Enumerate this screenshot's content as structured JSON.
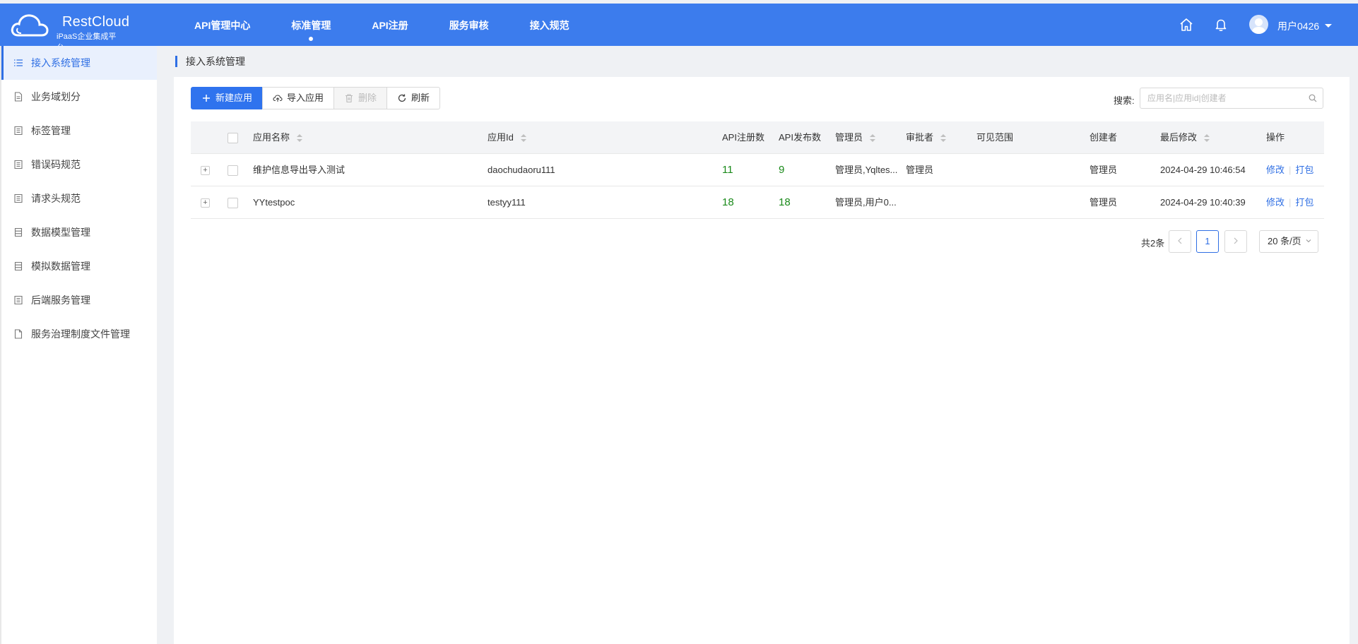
{
  "brand": {
    "title": "RestCloud",
    "subtitle": "iPaaS企业集成平台"
  },
  "topnav": [
    {
      "label": "API管理中心"
    },
    {
      "label": "标准管理",
      "active": true
    },
    {
      "label": "API注册"
    },
    {
      "label": "服务审核"
    },
    {
      "label": "接入规范"
    }
  ],
  "user": {
    "name": "用户0426"
  },
  "sidebar": {
    "items": [
      {
        "label": "接入系统管理",
        "icon": "list-icon",
        "active": true
      },
      {
        "label": "业务域划分",
        "icon": "document-icon"
      },
      {
        "label": "标签管理",
        "icon": "form-icon"
      },
      {
        "label": "错误码规范",
        "icon": "form-icon"
      },
      {
        "label": "请求头规范",
        "icon": "form-icon"
      },
      {
        "label": "数据模型管理",
        "icon": "database-icon"
      },
      {
        "label": "模拟数据管理",
        "icon": "database-icon"
      },
      {
        "label": "后端服务管理",
        "icon": "form-icon"
      },
      {
        "label": "服务治理制度文件管理",
        "icon": "file-icon"
      }
    ]
  },
  "breadcrumb": "接入系统管理",
  "toolbar": {
    "new_label": "新建应用",
    "import_label": "导入应用",
    "delete_label": "删除",
    "refresh_label": "刷新"
  },
  "search": {
    "label": "搜索:",
    "placeholder": "应用名|应用id|创建者"
  },
  "table": {
    "headers": {
      "name": "应用名称",
      "app_id": "应用Id",
      "api_reg": "API注册数",
      "api_pub": "API发布数",
      "admin": "管理员",
      "approver": "审批者",
      "scope": "可见范围",
      "creator": "创建者",
      "modified": "最后修改",
      "ops": "操作"
    },
    "rows": [
      {
        "name": "维护信息导出导入测试",
        "app_id": "daochudaoru111",
        "api_reg": "11",
        "api_pub": "9",
        "admin": "管理员,Yqltes...",
        "approver": "管理员",
        "scope": "",
        "creator": "管理员",
        "modified": "2024-04-29 10:46:54",
        "edit": "修改",
        "pack": "打包"
      },
      {
        "name": "YYtestpoc",
        "app_id": "testyy111",
        "api_reg": "18",
        "api_pub": "18",
        "admin": "管理员,用户0...",
        "approver": "",
        "scope": "",
        "creator": "管理员",
        "modified": "2024-04-29 10:40:39",
        "edit": "修改",
        "pack": "打包"
      }
    ]
  },
  "pagination": {
    "total": "共2条",
    "current_page": "1",
    "page_size": "20 条/页"
  },
  "colors": {
    "header_bg": "#3c7ced",
    "primary": "#2f73ee",
    "link": "#2f6fe4",
    "number_green": "#1a8a1a"
  }
}
